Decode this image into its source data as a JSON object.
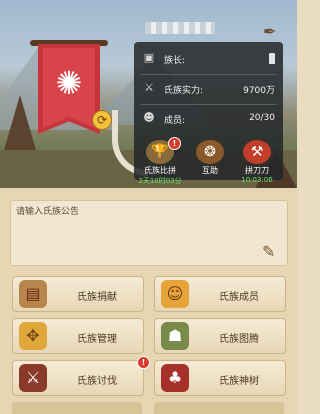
{
  "header": {
    "blurred_name": ""
  },
  "panel": {
    "leader_label": "族长:",
    "power_label": "氏族实力:",
    "power_value": "9700万",
    "members_label": "成员:",
    "members_value": "20/30"
  },
  "actions": [
    {
      "label": "氏族比拼",
      "sub": "2天10时03分",
      "badge": "!"
    },
    {
      "label": "互助",
      "sub": "",
      "badge": ""
    },
    {
      "label": "拼刀刀",
      "sub": "10:03:06",
      "badge": ""
    }
  ],
  "notice": {
    "placeholder": "请输入氏族公告"
  },
  "buttons": [
    {
      "label": "氏族捐献",
      "icon": "donation-chest-icon",
      "badge": ""
    },
    {
      "label": "氏族成员",
      "icon": "members-icon",
      "badge": ""
    },
    {
      "label": "氏族管理",
      "icon": "management-gear-icon",
      "badge": ""
    },
    {
      "label": "氏族图腾",
      "icon": "totem-icon",
      "badge": ""
    },
    {
      "label": "氏族讨伐",
      "icon": "crusade-icon",
      "badge": "!"
    },
    {
      "label": "氏族神树",
      "icon": "sacred-tree-icon",
      "badge": "!"
    }
  ],
  "colors": {
    "panel_bg": "#232629",
    "flag": "#c8343c",
    "timer_green": "#6fe06a",
    "badge": "#d93a2e"
  }
}
